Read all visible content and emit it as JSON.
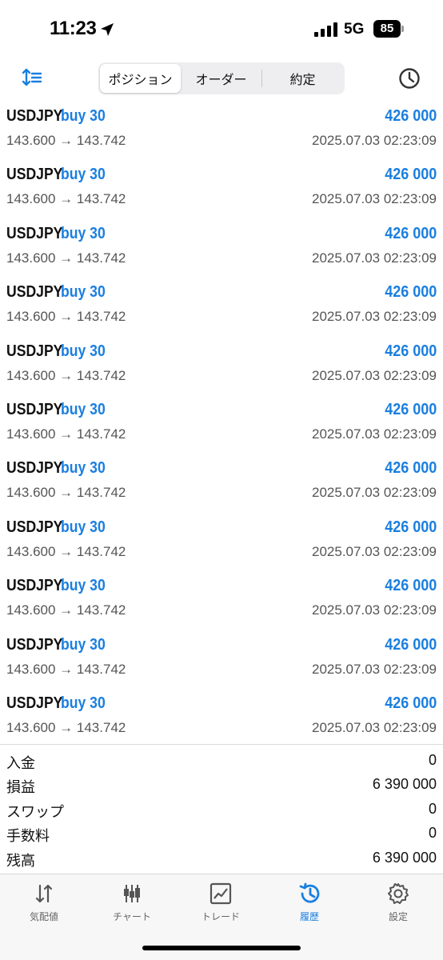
{
  "status_bar": {
    "time": "11:23",
    "network": "5G",
    "battery": "85",
    "location_icon": "location-arrow-icon",
    "signal_icon": "signal-bars-icon"
  },
  "toolbar": {
    "sort_icon": "sort-icon",
    "history_icon": "clock-icon",
    "tabs": [
      "ポジション",
      "オーダー",
      "約定"
    ],
    "active_tab": "ポジション"
  },
  "colors": {
    "accent": "#1a7fe0",
    "text": "#111111",
    "muted": "#555555"
  },
  "positions": [
    {
      "symbol": "USDJPY",
      "side": "buy 30",
      "profit": "426 000",
      "prices": "143.600 → 143.742",
      "time": "2025.07.03 02:23:09"
    },
    {
      "symbol": "USDJPY",
      "side": "buy 30",
      "profit": "426 000",
      "prices": "143.600 → 143.742",
      "time": "2025.07.03 02:23:09"
    },
    {
      "symbol": "USDJPY",
      "side": "buy 30",
      "profit": "426 000",
      "prices": "143.600 → 143.742",
      "time": "2025.07.03 02:23:09"
    },
    {
      "symbol": "USDJPY",
      "side": "buy 30",
      "profit": "426 000",
      "prices": "143.600 → 143.742",
      "time": "2025.07.03 02:23:09"
    },
    {
      "symbol": "USDJPY",
      "side": "buy 30",
      "profit": "426 000",
      "prices": "143.600 → 143.742",
      "time": "2025.07.03 02:23:09"
    },
    {
      "symbol": "USDJPY",
      "side": "buy 30",
      "profit": "426 000",
      "prices": "143.600 → 143.742",
      "time": "2025.07.03 02:23:09"
    },
    {
      "symbol": "USDJPY",
      "side": "buy 30",
      "profit": "426 000",
      "prices": "143.600 → 143.742",
      "time": "2025.07.03 02:23:09"
    },
    {
      "symbol": "USDJPY",
      "side": "buy 30",
      "profit": "426 000",
      "prices": "143.600 → 143.742",
      "time": "2025.07.03 02:23:09"
    },
    {
      "symbol": "USDJPY",
      "side": "buy 30",
      "profit": "426 000",
      "prices": "143.600 → 143.742",
      "time": "2025.07.03 02:23:09"
    },
    {
      "symbol": "USDJPY",
      "side": "buy 30",
      "profit": "426 000",
      "prices": "143.600 → 143.742",
      "time": "2025.07.03 02:23:09"
    },
    {
      "symbol": "USDJPY",
      "side": "buy 30",
      "profit": "426 000",
      "prices": "143.600 → 143.742",
      "time": "2025.07.03 02:23:09"
    }
  ],
  "summary": [
    {
      "label": "入金",
      "value": "0"
    },
    {
      "label": "損益",
      "value": "6 390 000"
    },
    {
      "label": "スワップ",
      "value": "0"
    },
    {
      "label": "手数料",
      "value": "0"
    },
    {
      "label": "残高",
      "value": "6 390 000"
    }
  ],
  "tabbar": [
    {
      "label": "気配値",
      "icon": "quotes-arrows-icon"
    },
    {
      "label": "チャート",
      "icon": "candlestick-icon"
    },
    {
      "label": "トレード",
      "icon": "trade-chart-icon"
    },
    {
      "label": "履歴",
      "icon": "history-clock-icon",
      "active": true
    },
    {
      "label": "設定",
      "icon": "gear-icon"
    }
  ]
}
